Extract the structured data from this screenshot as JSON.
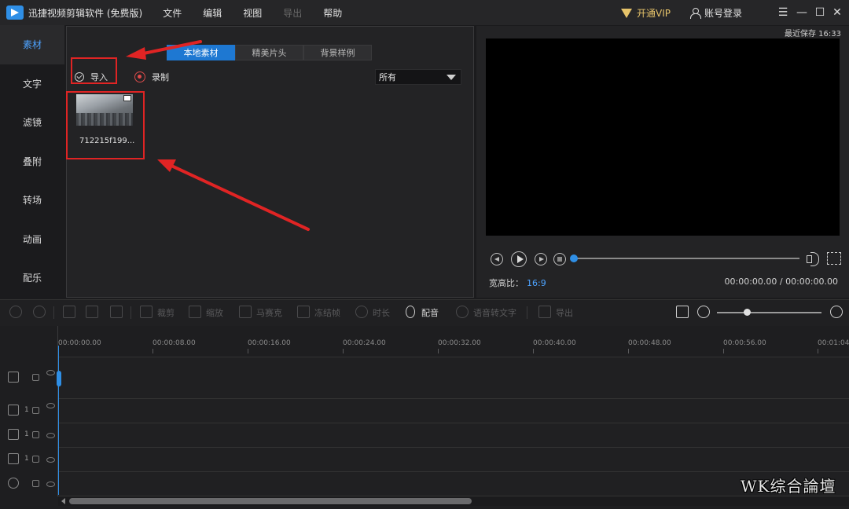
{
  "titlebar": {
    "app_title": "迅捷视频剪辑软件 (免费版)",
    "menu": [
      "文件",
      "编辑",
      "视图",
      "导出",
      "帮助"
    ],
    "vip_label": "开通VIP",
    "login_label": "账号登录",
    "controls": [
      "☰",
      "—",
      "☐",
      "✕"
    ]
  },
  "sidebar": {
    "items": [
      "素材",
      "文字",
      "滤镜",
      "叠附",
      "转场",
      "动画",
      "配乐"
    ],
    "active_index": 0
  },
  "material": {
    "tabs": [
      "本地素材",
      "精美片头",
      "背景样例"
    ],
    "active_tab": 0,
    "import_label": "导入",
    "record_label": "录制",
    "filter_value": "所有",
    "items": [
      {
        "name": "712215f199..."
      }
    ]
  },
  "preview": {
    "autosave": "最近保存 16:33",
    "ratio_label": "宽高比：",
    "ratio_value": "16:9",
    "timecode": "00:00:00.00 / 00:00:00.00",
    "progress": 0
  },
  "toolbar": {
    "labels": {
      "crop": "裁剪",
      "zoom": "缩放",
      "mosaic": "马赛克",
      "freeze": "冻结帧",
      "duration": "时长",
      "dub": "配音",
      "speech_to_text": "语音转文字",
      "export": "导出"
    },
    "zoom_level": 0.3
  },
  "timeline": {
    "ticks": [
      "00:00:00.00",
      "00:00:08.00",
      "00:00:16.00",
      "00:00:24.00",
      "00:00:32.00",
      "00:00:40.00",
      "00:00:48.00",
      "00:00:56.00",
      "00:01:04"
    ],
    "track_numbers": [
      "1",
      "1",
      "1"
    ]
  },
  "watermark": "WK综合論壇",
  "colors": {
    "accent": "#2f8fe6",
    "highlight": "#e02424",
    "vip": "#e6c36a"
  }
}
